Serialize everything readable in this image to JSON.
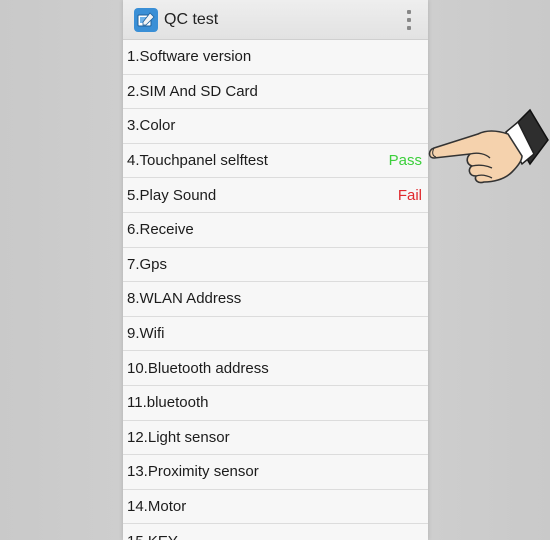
{
  "app": {
    "title": "QC test",
    "icon": "qc-app-icon",
    "menu_icon": "overflow-menu-icon"
  },
  "items": [
    {
      "label": "1.Software version",
      "status": ""
    },
    {
      "label": "2.SIM And SD Card",
      "status": ""
    },
    {
      "label": "3.Color",
      "status": ""
    },
    {
      "label": "4.Touchpanel selftest",
      "status": "Pass"
    },
    {
      "label": "5.Play Sound",
      "status": "Fail"
    },
    {
      "label": "6.Receive",
      "status": ""
    },
    {
      "label": "7.Gps",
      "status": ""
    },
    {
      "label": "8.WLAN Address",
      "status": ""
    },
    {
      "label": "9.Wifi",
      "status": ""
    },
    {
      "label": "10.Bluetooth address",
      "status": ""
    },
    {
      "label": "11.bluetooth",
      "status": ""
    },
    {
      "label": "12.Light sensor",
      "status": ""
    },
    {
      "label": "13.Proximity sensor",
      "status": ""
    },
    {
      "label": "14.Motor",
      "status": ""
    },
    {
      "label": "15.KEY",
      "status": ""
    }
  ],
  "colors": {
    "pass": "#3ccf3c",
    "fail": "#e0282d"
  },
  "pointer": "pointing-hand-icon"
}
